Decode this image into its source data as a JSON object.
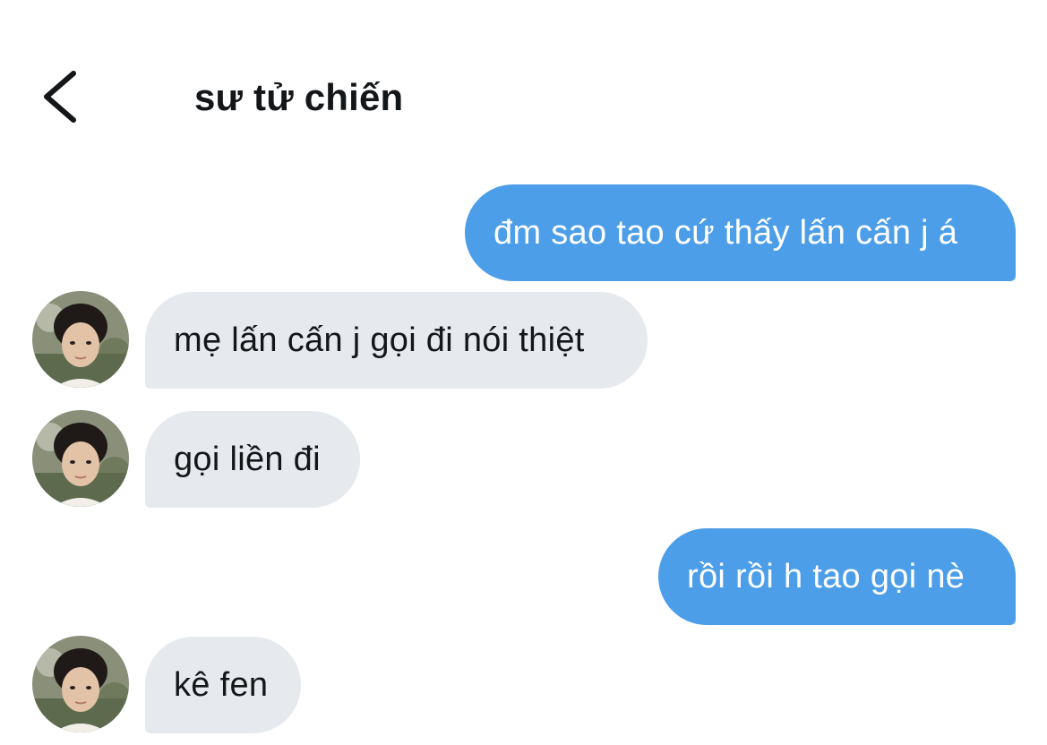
{
  "header": {
    "title": "sư tử chiến"
  },
  "messages": [
    {
      "direction": "sent",
      "text": "đm sao tao cứ thấy lấn cấn j á"
    },
    {
      "direction": "received",
      "text": "mẹ lấn cấn j gọi đi nói thiệt"
    },
    {
      "direction": "received",
      "text": "gọi liền đi"
    },
    {
      "direction": "sent",
      "text": "rồi rồi h tao gọi nè"
    },
    {
      "direction": "received",
      "text": "kê fen"
    }
  ],
  "colors": {
    "sent_bubble": "#4c9ee8",
    "received_bubble": "#e6e9ed",
    "text_dark": "#14171a"
  },
  "icons": {
    "back": "chevron-left-icon"
  }
}
